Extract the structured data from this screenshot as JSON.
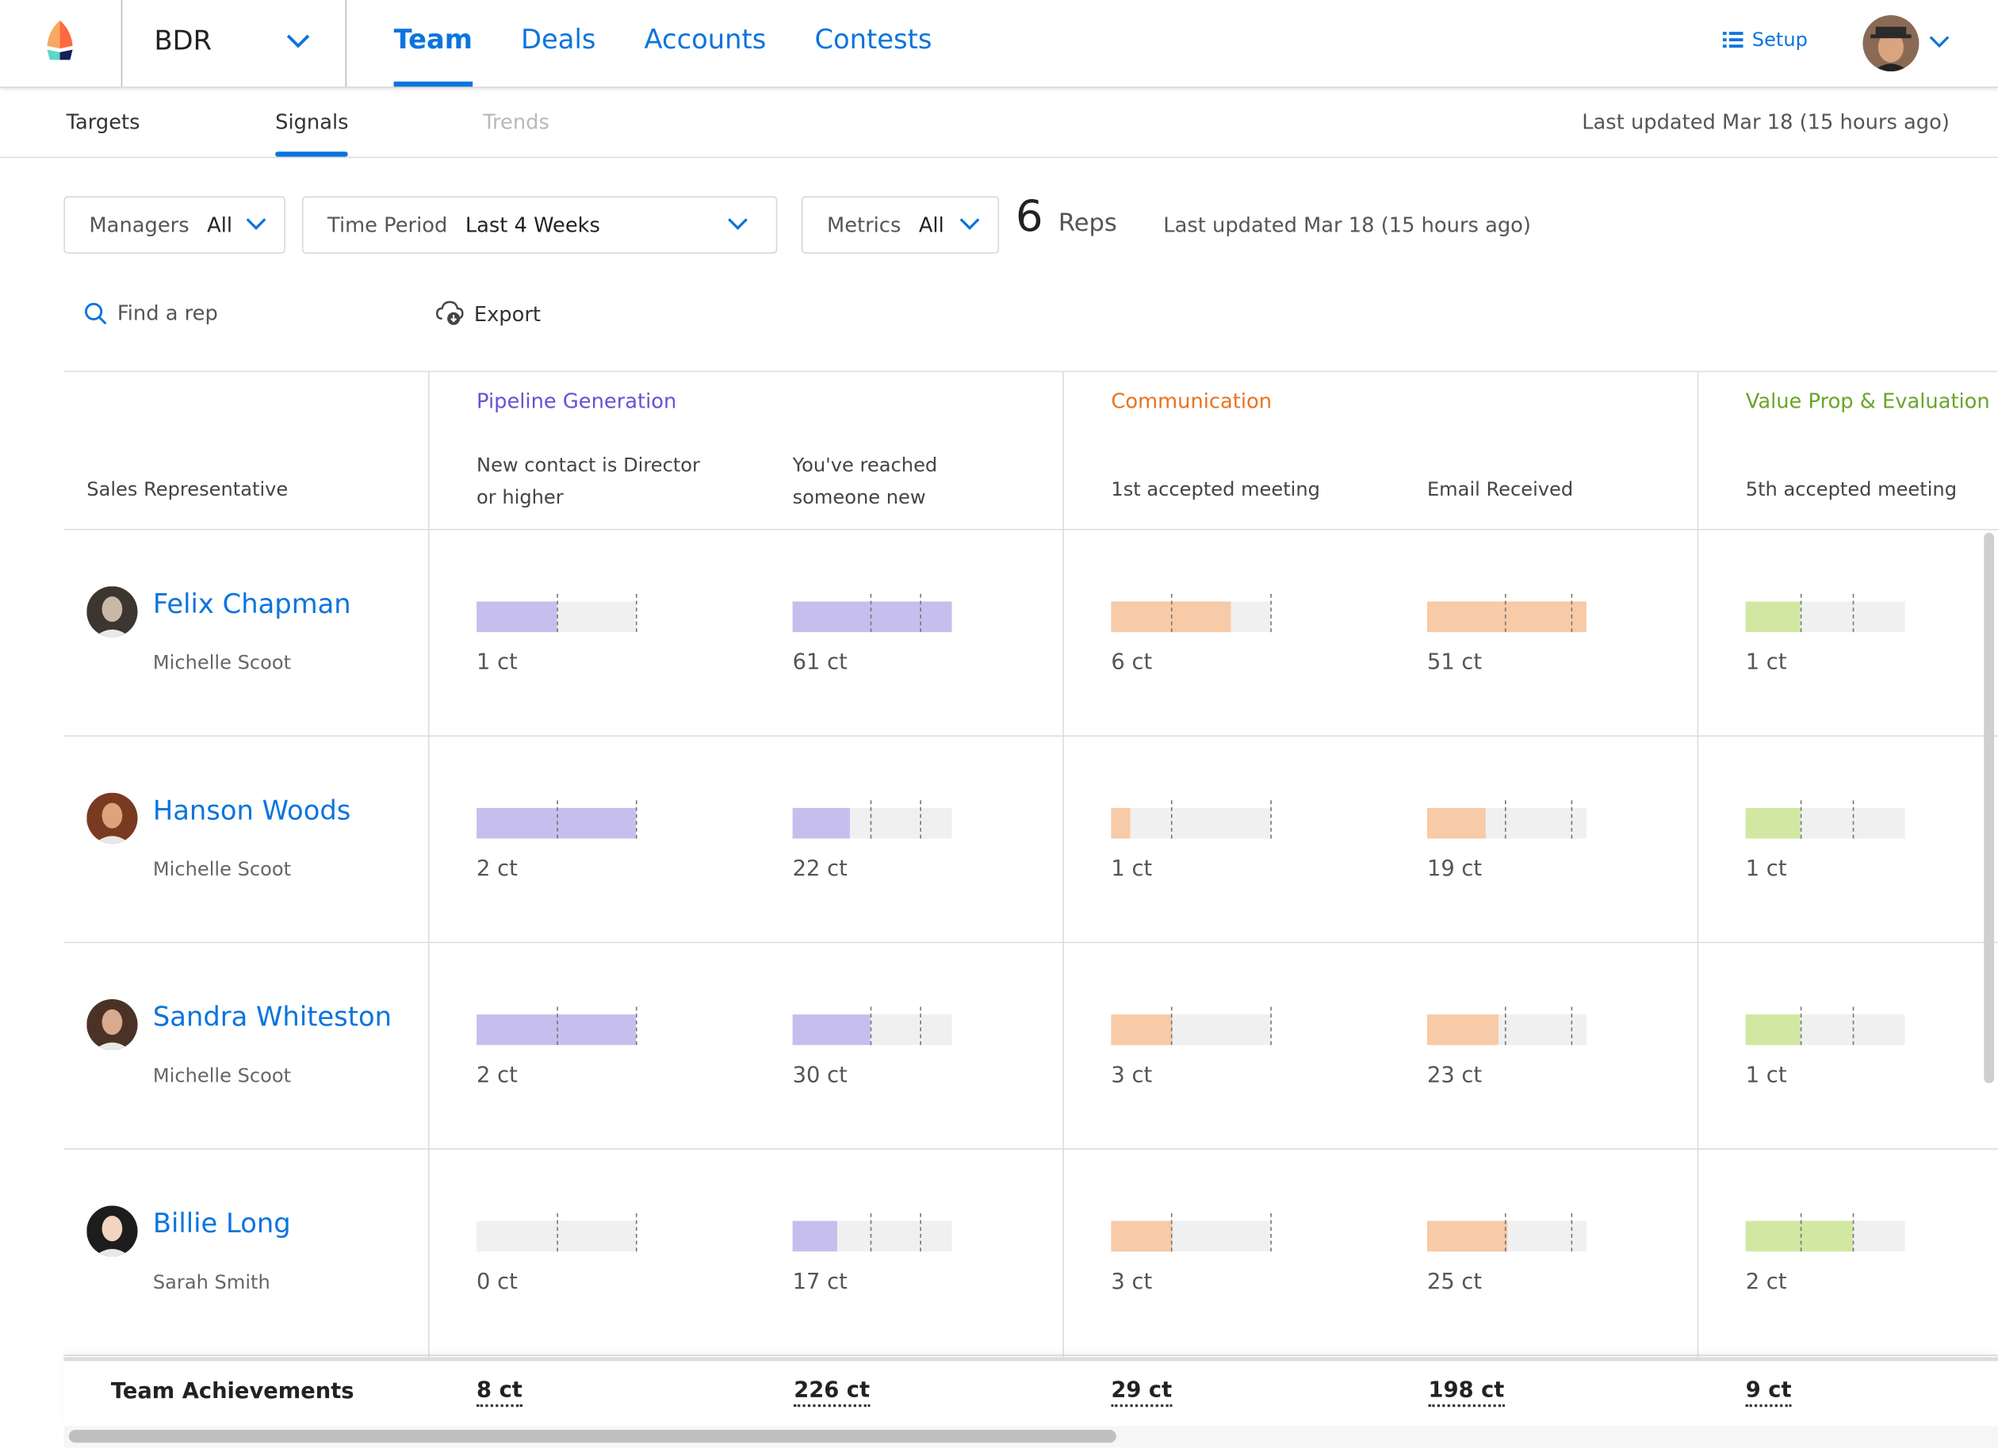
{
  "topbar": {
    "team_selector": "BDR",
    "nav": [
      {
        "label": "Team",
        "active": true
      },
      {
        "label": "Deals",
        "active": false
      },
      {
        "label": "Accounts",
        "active": false
      },
      {
        "label": "Contests",
        "active": false
      }
    ],
    "setup_label": "Setup"
  },
  "subnav": {
    "tabs": [
      {
        "label": "Targets",
        "state": "normal"
      },
      {
        "label": "Signals",
        "state": "active"
      },
      {
        "label": "Trends",
        "state": "disabled"
      }
    ],
    "last_updated": "Last updated Mar 18 (15 hours ago)"
  },
  "filters": {
    "managers": {
      "label": "Managers",
      "value": "All"
    },
    "time_period": {
      "label": "Time Period",
      "value": "Last 4 Weeks"
    },
    "metrics": {
      "label": "Metrics",
      "value": "All"
    },
    "reps_count": "6",
    "reps_label": "Reps",
    "last_updated": "Last updated Mar 18 (15 hours ago)"
  },
  "actions": {
    "find_placeholder": "Find a rep",
    "export_label": "Export"
  },
  "table": {
    "rep_header": "Sales Representative",
    "groups": [
      {
        "name": "Pipeline Generation",
        "color": "#6a4fd6"
      },
      {
        "name": "Communication",
        "color": "#e8731f"
      },
      {
        "name": "Value Prop & Evaluation",
        "color": "#6aa428"
      }
    ],
    "columns": [
      {
        "label": "New contact is Director or higher",
        "group": 0,
        "markers": [
          0.5,
          1.0
        ]
      },
      {
        "label": "You've reached someone new",
        "group": 0,
        "markers": [
          0.49,
          0.8
        ]
      },
      {
        "label": "1st accepted meeting",
        "group": 1,
        "markers": [
          0.375,
          1.0
        ]
      },
      {
        "label": "Email Received",
        "group": 1,
        "markers": [
          0.49,
          0.9
        ]
      },
      {
        "label": "5th accepted meeting",
        "group": 2,
        "markers": [
          0.34,
          0.67
        ]
      }
    ],
    "bar_colors": [
      "#c6bfee",
      "#c6bfee",
      "#f7caa8",
      "#f7caa8",
      "#d2e8a2"
    ],
    "rows": [
      {
        "name": "Felix Chapman",
        "manager": "Michelle Scoot",
        "values": [
          "1 ct",
          "61 ct",
          "6 ct",
          "51 ct",
          "1 ct"
        ],
        "progress": [
          0.5,
          1.0,
          0.75,
          1.0,
          0.34
        ]
      },
      {
        "name": "Hanson Woods",
        "manager": "Michelle Scoot",
        "values": [
          "2 ct",
          "22 ct",
          "1 ct",
          "19 ct",
          "1 ct"
        ],
        "progress": [
          1.0,
          0.36,
          0.12,
          0.37,
          0.34
        ]
      },
      {
        "name": "Sandra Whiteston",
        "manager": "Michelle Scoot",
        "values": [
          "2 ct",
          "30 ct",
          "3 ct",
          "23 ct",
          "1 ct"
        ],
        "progress": [
          1.0,
          0.49,
          0.38,
          0.45,
          0.34
        ]
      },
      {
        "name": "Billie Long",
        "manager": "Sarah Smith",
        "values": [
          "0 ct",
          "17 ct",
          "3 ct",
          "25 ct",
          "2 ct"
        ],
        "progress": [
          0.0,
          0.28,
          0.38,
          0.5,
          0.67
        ]
      }
    ],
    "footer_label": "Team Achievements",
    "totals": [
      "8 ct",
      "226 ct",
      "29 ct",
      "198 ct",
      "9 ct"
    ]
  }
}
